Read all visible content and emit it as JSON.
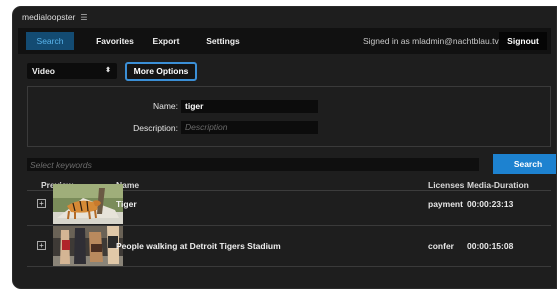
{
  "app": {
    "title": "medialoopster",
    "menu_icon": "hamburger-icon"
  },
  "nav": {
    "tabs": [
      {
        "label": "Search",
        "active": true
      },
      {
        "label": "Favorites",
        "active": false
      },
      {
        "label": "Export",
        "active": false
      },
      {
        "label": "Settings",
        "active": false
      }
    ],
    "signed_in_text": "Signed in as mladmin@nachtblau.tv",
    "signout_label": "Signout"
  },
  "filter": {
    "type_value": "Video",
    "more_options_label": "More Options"
  },
  "options": {
    "name_label": "Name:",
    "name_value": "tiger",
    "description_label": "Description:",
    "description_placeholder": "Description"
  },
  "search": {
    "keywords_placeholder": "Select keywords",
    "button_label": "Search"
  },
  "results": {
    "columns": {
      "preview": "Preview",
      "name": "Name",
      "licenses": "Licenses",
      "duration": "Media-Duration"
    },
    "rows": [
      {
        "name": "Tiger",
        "license": "payment",
        "duration": "00:00:23:13"
      },
      {
        "name": "People walking at Detroit Tigers Stadium",
        "license": "confer",
        "duration": "00:00:15:08"
      }
    ]
  },
  "colors": {
    "window_bg": "#1e1e1e",
    "navbar_bg": "#111111",
    "active_tab_bg": "#134b72",
    "active_tab_text": "#59b4ec",
    "accent": "#1d82d0"
  }
}
